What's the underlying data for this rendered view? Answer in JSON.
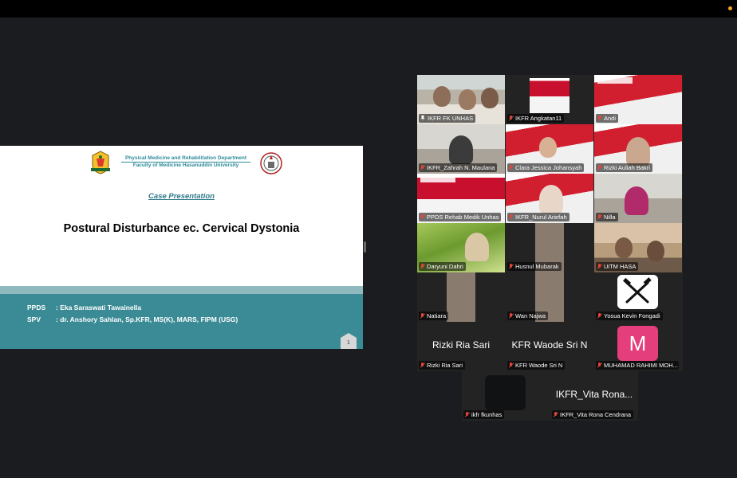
{
  "slide": {
    "department_line1": "Physical Medicine and Rehabilitation Department",
    "department_line2": "Faculty of Medicine Hasanuddin University",
    "subtitle": "Case Presentation",
    "title": "Postural Disturbance ec. Cervical Dystonia",
    "ppds_label": "PPDS",
    "ppds_value": ":  Eka Saraswati Tawainella",
    "spv_label": "SPV",
    "spv_value": ": dr. Anshory Sahlan, Sp.KFR, MS(K), MARS, FIPM (USG)",
    "page_number": "1"
  },
  "participants": [
    {
      "name": "IKFR FK UNHAS",
      "pinned": true
    },
    {
      "name": "IKFR Angkatan11"
    },
    {
      "name": "Andi"
    },
    {
      "name": "IKFR_Zahrah N. Maulana"
    },
    {
      "name": "Clara Jessica Johansyah"
    },
    {
      "name": "Rizki Auliah Bakri"
    },
    {
      "name": "PPDS Rehab Medik Unhas"
    },
    {
      "name": "IKFR_Nurul Ariefah"
    },
    {
      "name": "Nilla"
    },
    {
      "name": "Daryuni Dahri"
    },
    {
      "name": "Husnul Mubarak"
    },
    {
      "name": "UiTM HASA"
    },
    {
      "name": "Natiara"
    },
    {
      "name": "Wan Najwa"
    },
    {
      "name": "Yosua Kevin Fongadi"
    },
    {
      "name": "Rizki Ria Sari",
      "display": "Rizki Ria Sari"
    },
    {
      "name": "KFR Waode Sri N",
      "display": "KFR Waode Sri N"
    },
    {
      "name": "MUHAMAD RAHIMI MOH...",
      "avatar_letter": "M"
    },
    {
      "name": "ikfr fkunhas"
    },
    {
      "name": "IKFR_Vita Rona Cendrana",
      "display": "IKFR_Vita Rona..."
    }
  ],
  "colors": {
    "accent_teal": "#3b8b96",
    "muted_mic": "#e0463a",
    "avatar_pink": "#e43f7c"
  }
}
